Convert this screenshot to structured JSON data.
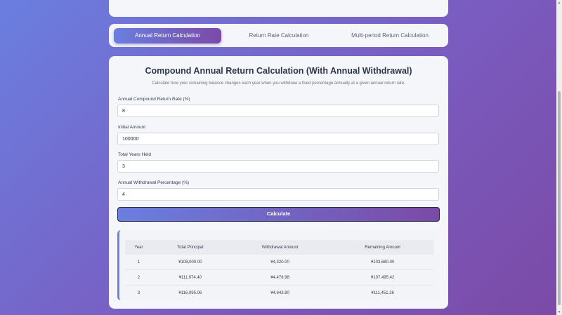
{
  "tabs": [
    {
      "label": "Annual Return Calculation",
      "active": true
    },
    {
      "label": "Return Rate Calculation",
      "active": false
    },
    {
      "label": "Multi-period Return Calculation",
      "active": false
    }
  ],
  "main": {
    "title": "Compound Annual Return Calculation (With Annual Withdrawal)",
    "subtitle": "Calculate how your remaining balance changes each year when you withdraw a fixed percentage annually at a given annual return rate."
  },
  "form": {
    "rate": {
      "label": "Annual Compound Return Rate (%)",
      "value": "8"
    },
    "initial": {
      "label": "Initial Amount",
      "value": "100000"
    },
    "years": {
      "label": "Total Years Held",
      "value": "3"
    },
    "withdrawal": {
      "label": "Annual Withdrawal Percentage (%)",
      "value": "4"
    },
    "calculate_label": "Calculate"
  },
  "results": {
    "headers": [
      "Year",
      "Total Principal",
      "Withdrawal Amount",
      "Remaining Amount"
    ],
    "rows": [
      [
        "1",
        "¥108,000.00",
        "¥4,320.00",
        "¥103,680.00"
      ],
      [
        "2",
        "¥111,974.40",
        "¥4,478.98",
        "¥107,495.42"
      ],
      [
        "3",
        "¥116,095.06",
        "¥4,643.80",
        "¥111,451.26"
      ]
    ]
  },
  "colors": {
    "accent_start": "#6a7fe0",
    "accent_end": "#7b4aa6"
  }
}
